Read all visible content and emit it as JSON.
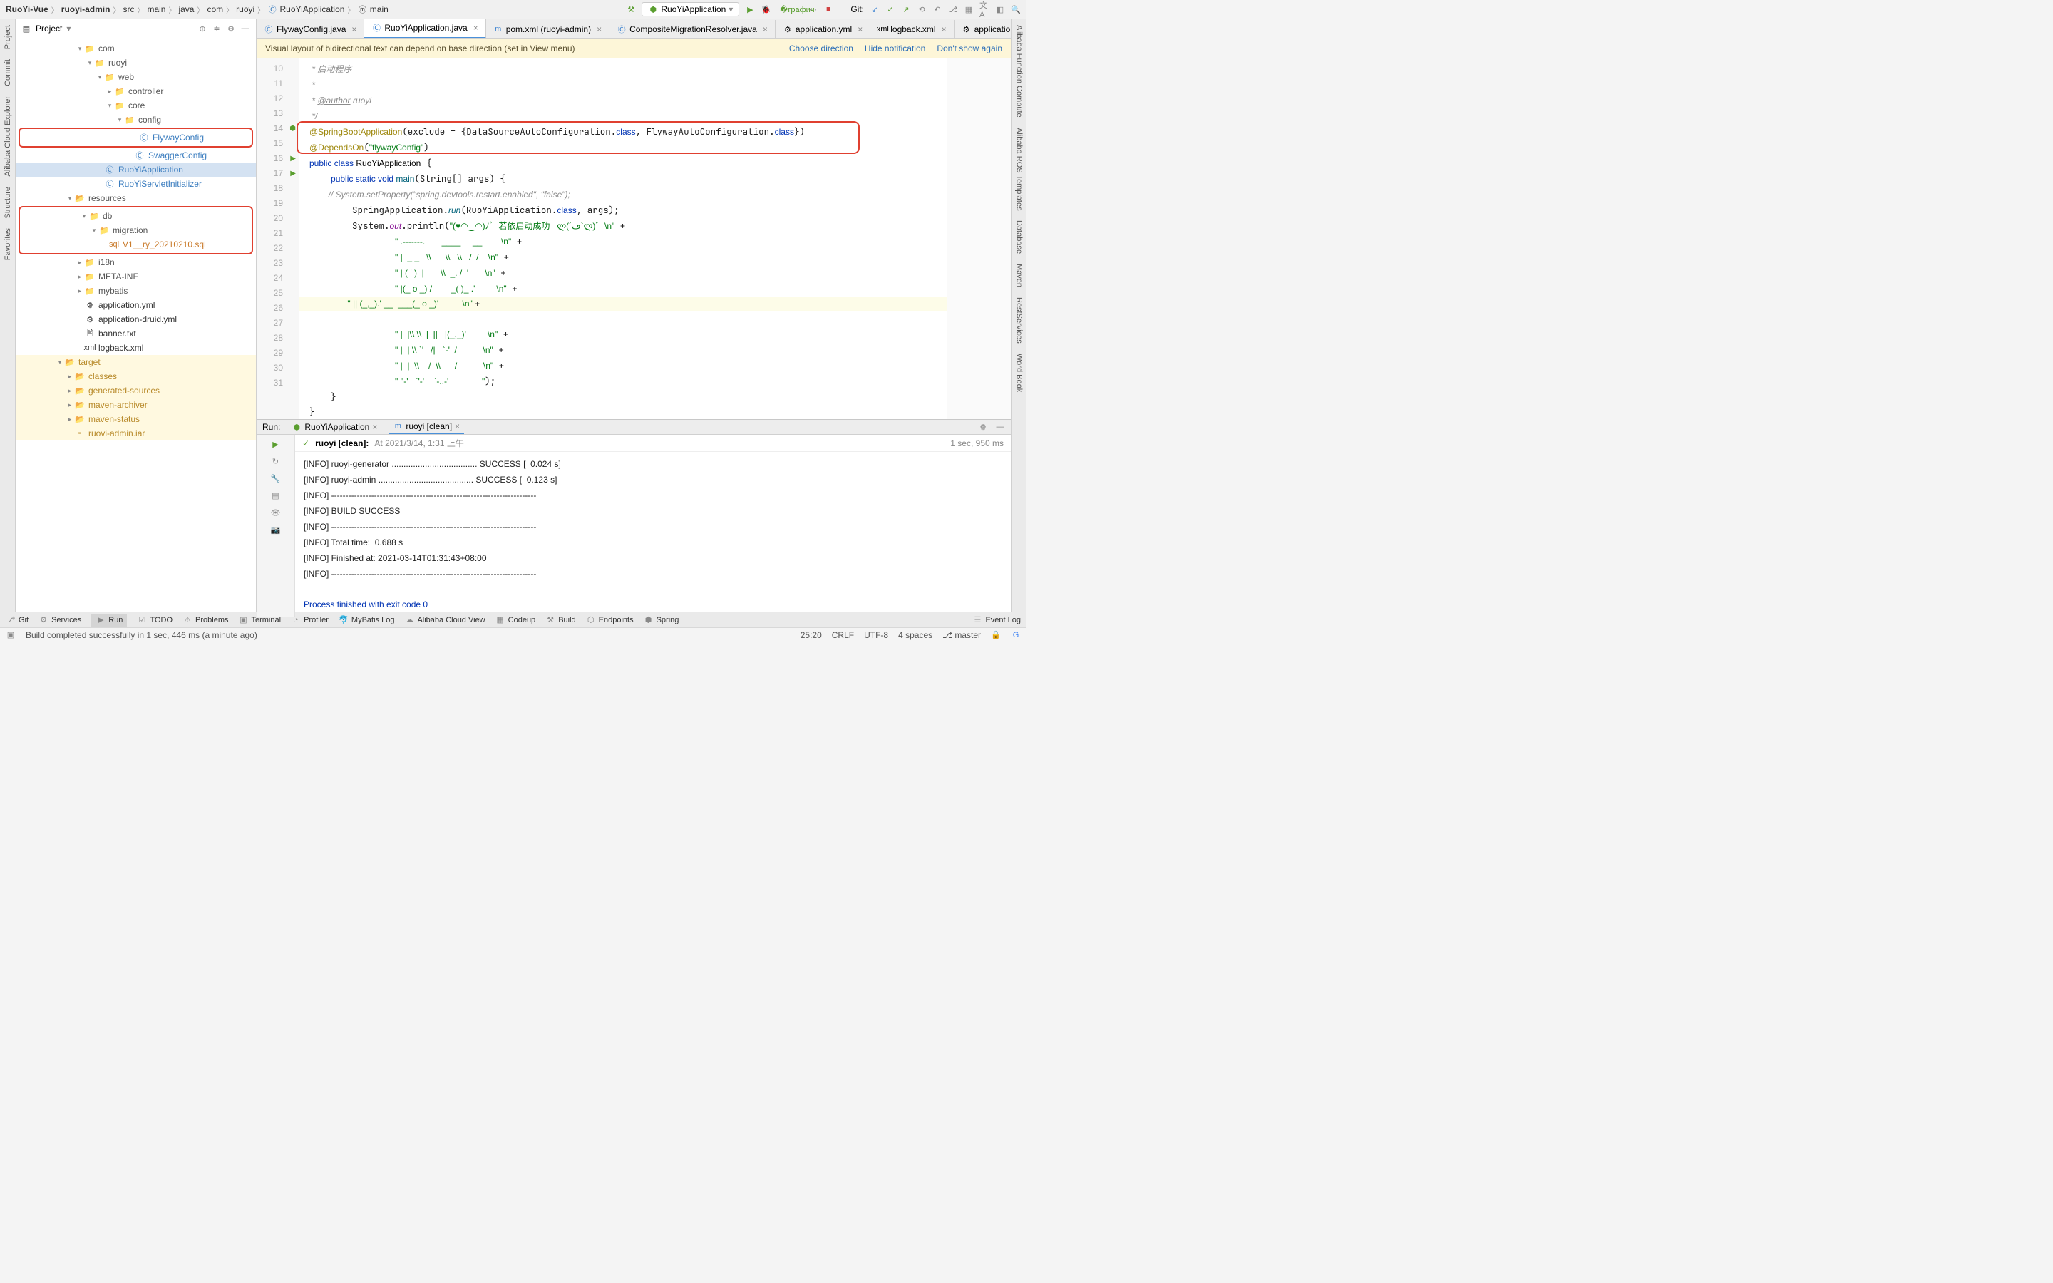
{
  "breadcrumb": [
    "RuoYi-Vue",
    "ruoyi-admin",
    "src",
    "main",
    "java",
    "com",
    "ruoyi",
    "RuoYiApplication",
    "main"
  ],
  "runconfig": {
    "label": "RuoYiApplication"
  },
  "toolbar": {
    "git_label": "Git:"
  },
  "project": {
    "title": "Project",
    "tree": [
      {
        "d": 6,
        "a": "v",
        "i": "📁",
        "t": "com",
        "c": "#555"
      },
      {
        "d": 7,
        "a": "v",
        "i": "📁",
        "t": "ruoyi",
        "c": "#555"
      },
      {
        "d": 8,
        "a": "v",
        "i": "📁",
        "t": "web",
        "c": "#555"
      },
      {
        "d": 9,
        "a": ">",
        "i": "📁",
        "t": "controller",
        "c": "#555"
      },
      {
        "d": 9,
        "a": "v",
        "i": "📁",
        "t": "core",
        "c": "#555"
      },
      {
        "d": 10,
        "a": "v",
        "i": "📁",
        "t": "config",
        "c": "#555"
      },
      {
        "d": 11,
        "a": "",
        "i": "Ⓒ",
        "t": "FlywayConfig",
        "c": "#3b7dbf",
        "box": "top"
      },
      {
        "d": 11,
        "a": "",
        "i": "Ⓒ",
        "t": "SwaggerConfig",
        "c": "#3b7dbf"
      },
      {
        "d": 8,
        "a": "",
        "i": "Ⓒ",
        "t": "RuoYiApplication",
        "c": "#3b7dbf",
        "hl": true
      },
      {
        "d": 8,
        "a": "",
        "i": "Ⓒ",
        "t": "RuoYiServletInitializer",
        "c": "#3b7dbf"
      },
      {
        "d": 5,
        "a": "v",
        "i": "📂",
        "t": "resources",
        "c": "#555"
      },
      {
        "d": 6,
        "a": "v",
        "i": "📁",
        "t": "db",
        "c": "#555",
        "box": "start"
      },
      {
        "d": 7,
        "a": "v",
        "i": "📁",
        "t": "migration",
        "c": "#555",
        "box": "mid"
      },
      {
        "d": 8,
        "a": "",
        "i": "sql",
        "t": "V1__ry_20210210.sql",
        "c": "#c97a2a",
        "box": "end"
      },
      {
        "d": 6,
        "a": ">",
        "i": "📁",
        "t": "i18n",
        "c": "#555"
      },
      {
        "d": 6,
        "a": ">",
        "i": "📁",
        "t": "META-INF",
        "c": "#555"
      },
      {
        "d": 6,
        "a": ">",
        "i": "📁",
        "t": "mybatis",
        "c": "#555"
      },
      {
        "d": 6,
        "a": "",
        "i": "⚙",
        "t": "application.yml",
        "c": "#333"
      },
      {
        "d": 6,
        "a": "",
        "i": "⚙",
        "t": "application-druid.yml",
        "c": "#333"
      },
      {
        "d": 6,
        "a": "",
        "i": "🖹",
        "t": "banner.txt",
        "c": "#333"
      },
      {
        "d": 6,
        "a": "",
        "i": "xml",
        "t": "logback.xml",
        "c": "#333"
      },
      {
        "d": 4,
        "a": "v",
        "i": "📂",
        "t": "target",
        "c": "#b88a2a",
        "tgt": true
      },
      {
        "d": 5,
        "a": ">",
        "i": "📂",
        "t": "classes",
        "c": "#b88a2a",
        "tgt": true
      },
      {
        "d": 5,
        "a": ">",
        "i": "📂",
        "t": "generated-sources",
        "c": "#b88a2a",
        "tgt": true
      },
      {
        "d": 5,
        "a": ">",
        "i": "📂",
        "t": "maven-archiver",
        "c": "#b88a2a",
        "tgt": true
      },
      {
        "d": 5,
        "a": ">",
        "i": "📂",
        "t": "maven-status",
        "c": "#b88a2a",
        "tgt": true
      },
      {
        "d": 5,
        "a": "",
        "i": "▫",
        "t": "ruovi-admin.iar",
        "c": "#b88a2a",
        "tgt": true
      }
    ]
  },
  "tabs": [
    {
      "icon": "Ⓒ",
      "label": "FlywayConfig.java",
      "active": false
    },
    {
      "icon": "Ⓒ",
      "label": "RuoYiApplication.java",
      "active": true
    },
    {
      "icon": "m",
      "label": "pom.xml (ruoyi-admin)",
      "active": false
    },
    {
      "icon": "Ⓒ",
      "label": "CompositeMigrationResolver.java",
      "active": false
    },
    {
      "icon": "⚙",
      "label": "application.yml",
      "active": false
    },
    {
      "icon": "xml",
      "label": "logback.xml",
      "active": false
    },
    {
      "icon": "⚙",
      "label": "application-dr",
      "active": false
    }
  ],
  "banner": {
    "msg": "Visual layout of bidirectional text can depend on base direction (set in View menu)",
    "a1": "Choose direction",
    "a2": "Hide notification",
    "a3": "Don't show again"
  },
  "gutter": [
    10,
    11,
    12,
    13,
    14,
    15,
    16,
    17,
    18,
    19,
    20,
    21,
    22,
    23,
    24,
    25,
    26,
    27,
    28,
    29,
    30,
    31
  ],
  "code": {
    "l10": " * 启动程序",
    "l11": " *",
    "l12a": " * ",
    "l12b": "@author",
    "l12c": " ruoyi",
    "l13": " */",
    "l14a": "@SpringBootApplication",
    "l14b": "(exclude = {DataSourceAutoConfiguration.",
    "l14c": "class",
    "l14d": ", FlywayAutoConfiguration.",
    "l14e": "class",
    "l14f": "})",
    "l15a": "@DependsOn",
    "l15b": "(",
    "l15c": "\"flywayConfig\"",
    "l15d": ")",
    "l16a": "public class ",
    "l16b": "RuoYiApplication",
    " l16c": " {",
    "l17a": "    public static void ",
    "l17b": "main",
    "l17c": "(String[] args) {",
    "l18": "        // System.setProperty(\"spring.devtools.restart.enabled\", \"false\");",
    "l19a": "        SpringApplication.",
    "l19b": "run",
    "l19c": "(RuoYiApplication.",
    "l19d": "class",
    "l19e": ", args);",
    "l20a": "        System.",
    "l20b": "out",
    "l20c": ".println(",
    "l20d": "\"(♥◠‿◠)ﾉﾞ  若依启动成功   ლ(´ڡ`ლ)ﾞ  \\n\"",
    "l20e": " +",
    "l21a": "                ",
    "l21b": "\" .-------.       ____     __        \\n\"",
    "l21c": " +",
    "l22a": "                ",
    "l22b": "\" |  _ _   \\\\      \\\\   \\\\   /  /    \\n\"",
    "l22c": " +",
    "l23a": "                ",
    "l23b": "\" | ( ' )  |       \\\\  _. /  '       \\n\"",
    "l23c": " +",
    "l24a": "                ",
    "l24b": "\" |(_ o _) /        _( )_ .'         \\n\"",
    "l24c": " +",
    "l25a": "                ",
    "l25b": "\" || (_,_).' __  ___(_ o _)'          \\n\"",
    "l25c": " +",
    "l26a": "                ",
    "l26b": "\" |  |\\\\ \\\\  |  ||   |(_,_)'         \\n\"",
    "l26c": " +",
    "l27a": "                ",
    "l27b": "\" |  | \\\\ `'   /|   `-'  /           \\n\"",
    "l27c": " +",
    "l28a": "                ",
    "l28b": "\" |  |  \\\\    /  \\\\      /           \\n\"",
    "l28c": " +",
    "l29a": "                ",
    "l29b": "\" ''-'   `'-'    `-..-'              \"",
    "l29c": ");",
    "l30": "    }",
    "l31": "}"
  },
  "run": {
    "title": "Run:",
    "tabs": [
      {
        "label": "RuoYiApplication"
      },
      {
        "label": "ruoyi [clean]"
      }
    ],
    "status_label": "ruoyi [clean]:",
    "status_text": "At 2021/3/14, 1:31 上午",
    "status_time": "1 sec, 950 ms",
    "console": "[INFO] ruoyi-generator .................................... SUCCESS [  0.024 s]\n[INFO] ruoyi-admin ........................................ SUCCESS [  0.123 s]\n[INFO] ------------------------------------------------------------------------\n[INFO] BUILD SUCCESS\n[INFO] ------------------------------------------------------------------------\n[INFO] Total time:  0.688 s\n[INFO] Finished at: 2021-03-14T01:31:43+08:00\n[INFO] ------------------------------------------------------------------------\n",
    "exit": "Process finished with exit code 0"
  },
  "bottom": [
    "Git",
    "Services",
    "Run",
    "TODO",
    "Problems",
    "Terminal",
    "Profiler",
    "MyBatis Log",
    "Alibaba Cloud View",
    "Codeup",
    "Build",
    "Endpoints",
    "Spring"
  ],
  "bottom_right": "Event Log",
  "status": {
    "msg": "Build completed successfully in 1 sec, 446 ms (a minute ago)",
    "pos": "25:20",
    "eol": "CRLF",
    "enc": "UTF-8",
    "indent": "4 spaces",
    "branch": "master"
  },
  "sidestrips": {
    "left": [
      "Project",
      "Commit",
      "Alibaba Cloud Explorer",
      "Structure",
      "Favorites"
    ],
    "right": [
      "Alibaba Function Compute",
      "Alibaba ROS Templates",
      "Database",
      "Maven",
      "RestServices",
      "Word Book"
    ]
  }
}
